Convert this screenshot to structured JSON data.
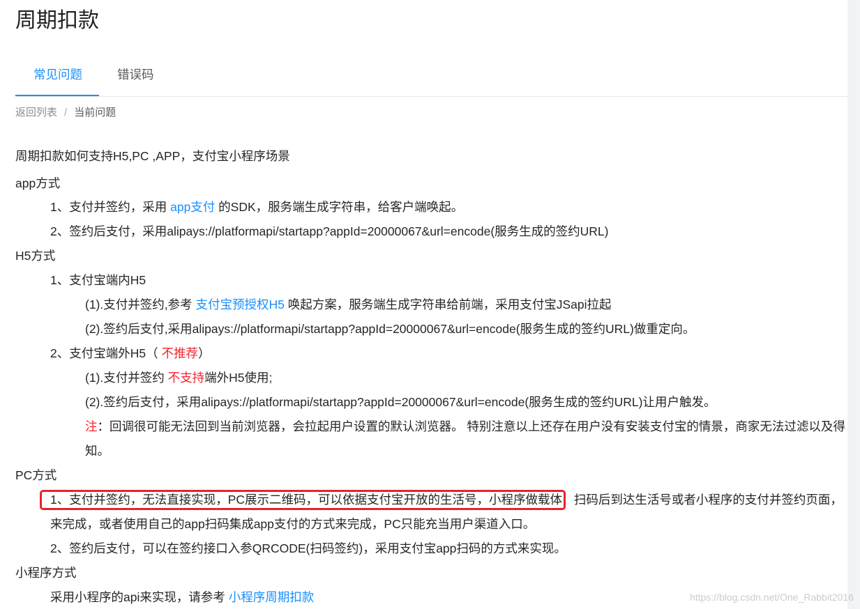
{
  "colors": {
    "accent": "#1890ff",
    "text": "#262626",
    "warning_red": "#f5222d",
    "annotation_red": "#e5252a"
  },
  "page_title": "周期扣款",
  "tabs": [
    {
      "label": "常见问题",
      "active": true
    },
    {
      "label": "错误码",
      "active": false
    }
  ],
  "breadcrumb": {
    "back_link": "返回列表",
    "separator": "/",
    "current": "当前问题"
  },
  "article": {
    "question": "周期扣款如何支持H5,PC ,APP，支付宝小程序场景",
    "app_section": {
      "heading": "app方式",
      "step1": {
        "before": "1、支付并签约，采用 ",
        "link": "app支付",
        "after": " 的SDK，服务端生成字符串，给客户端唤起。"
      },
      "step2": "2、签约后支付，采用alipays://platformapi/startapp?appId=20000067&url=encode(服务生成的签约URL)"
    },
    "h5_section": {
      "heading": "H5方式",
      "inside_app": {
        "title": "1、支付宝端内H5",
        "sub1": {
          "before": "(1).支付并签约,参考 ",
          "link": "支付宝预授权H5",
          "after": " 唤起方案，服务端生成字符串给前端，采用支付宝JSapi拉起"
        },
        "sub2": "(2).签约后支付,采用alipays://platformapi/startapp?appId=20000067&url=encode(服务生成的签约URL)做重定向。"
      },
      "outside_app": {
        "title_before": "2、支付宝端外H5（ ",
        "title_warning": "不推荐",
        "title_after": "）",
        "sub1": {
          "before": "(1).支付并签约 ",
          "warning": "不支持",
          "after": "端外H5使用;"
        },
        "sub2": "(2).签约后支付，采用alipays://platformapi/startapp?appId=20000067&url=encode(服务生成的签约URL)让用户触发。",
        "note": {
          "label": "注",
          "lines": [
            "：回调很可能无法回到当前浏览器，会拉起用户设置的默认浏览器。 特别注意以上还存在用户没有安装支付宝的情景，商家无法过滤以及得",
            "知。"
          ]
        }
      }
    },
    "pc_section": {
      "heading": "PC方式",
      "step1": {
        "highlighted": "1、支付并签约，无法直接实现，PC展示二维码，可以依据支付宝开放的生活号，小程序做载体",
        "rest_line1": " 扫码后到达生活号或者小程序的支付并签约页面，",
        "rest_line2": "来完成，或者使用自己的app扫码集成app支付的方式来完成，PC只能充当用户渠道入口。"
      },
      "step2": "2、签约后支付，可以在签约接口入参QRCODE(扫码签约)，采用支付宝app扫码的方式来实现。"
    },
    "mini_program_section": {
      "heading": "小程序方式",
      "text": {
        "before": "采用小程序的api来实现，请参考 ",
        "link": "小程序周期扣款"
      }
    }
  },
  "watermark": "https://blog.csdn.net/One_Rabbit2016"
}
